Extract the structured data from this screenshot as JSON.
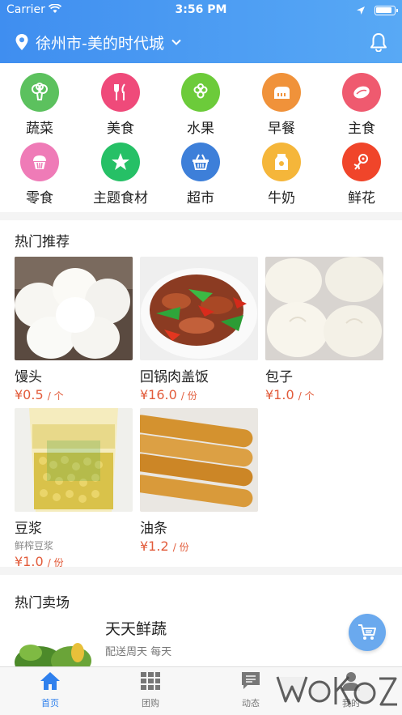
{
  "status_bar": {
    "carrier": "Carrier",
    "time": "3:56 PM"
  },
  "header": {
    "location": "徐州市-美的时代城"
  },
  "categories": [
    {
      "label": "蔬菜",
      "color": "#5cc15e",
      "icon": "broccoli-icon"
    },
    {
      "label": "美食",
      "color": "#ef4a7a",
      "icon": "fork-knife-icon"
    },
    {
      "label": "水果",
      "color": "#6ccb3a",
      "icon": "grapes-icon"
    },
    {
      "label": "早餐",
      "color": "#f0923a",
      "icon": "bread-icon"
    },
    {
      "label": "主食",
      "color": "#ef5a6f",
      "icon": "rice-icon"
    },
    {
      "label": "零食",
      "color": "#ef7bb7",
      "icon": "cupcake-icon"
    },
    {
      "label": "主题食材",
      "color": "#26c066",
      "icon": "star-icon"
    },
    {
      "label": "超市",
      "color": "#3d7fd9",
      "icon": "basket-icon"
    },
    {
      "label": "牛奶",
      "color": "#f5b63a",
      "icon": "milk-icon"
    },
    {
      "label": "鲜花",
      "color": "#f0452a",
      "icon": "flower-icon"
    }
  ],
  "hot_recommend": {
    "title": "热门推荐",
    "items": [
      {
        "name": "馒头",
        "sub": "",
        "price": "¥0.5",
        "unit": "/ 个"
      },
      {
        "name": "回锅肉盖饭",
        "sub": "",
        "price": "¥16.0",
        "unit": "/ 份"
      },
      {
        "name": "包子",
        "sub": "",
        "price": "¥1.0",
        "unit": "/ 个"
      },
      {
        "name": "豆浆",
        "sub": "鲜榨豆浆",
        "price": "¥1.0",
        "unit": "/ 份"
      },
      {
        "name": "油条",
        "sub": "",
        "price": "¥1.2",
        "unit": "/ 份"
      }
    ]
  },
  "hot_market": {
    "title": "热门卖场",
    "store": {
      "name": "天天鲜蔬",
      "desc": "配送周天 每天"
    }
  },
  "tabbar": [
    {
      "label": "首页",
      "icon": "home-icon",
      "active": true
    },
    {
      "label": "团购",
      "icon": "grid-icon",
      "active": false
    },
    {
      "label": "动态",
      "icon": "message-icon",
      "active": false
    },
    {
      "label": "我的",
      "icon": "user-icon",
      "active": false
    }
  ],
  "colors": {
    "header": "#3f8ef0",
    "price": "#e25b3a",
    "tab_active": "#2f80ed"
  }
}
